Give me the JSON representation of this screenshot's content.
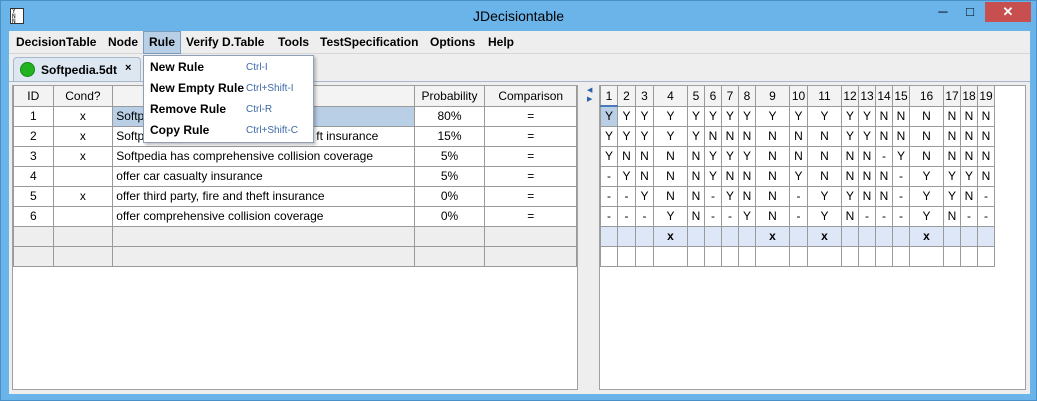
{
  "window": {
    "title": "JDecisiontable",
    "icon_text": "Y N\nN -",
    "minimize_glyph": "─",
    "maximize_glyph": "□",
    "close_glyph": "✕"
  },
  "menu": [
    "DecisionTable",
    "Node",
    "Rule",
    "Verify D.Table",
    "Tools",
    "TestSpecification",
    "Options",
    "Help"
  ],
  "rule_menu": {
    "items": [
      {
        "label": "New Rule",
        "accel": "Ctrl-I"
      },
      {
        "label": "New Empty Rule",
        "accel": "Ctrl+Shift-I"
      },
      {
        "label": "Remove Rule",
        "accel": "Ctrl-R"
      },
      {
        "label": "Copy Rule",
        "accel": "Ctrl+Shift-C"
      }
    ]
  },
  "tab": {
    "label": "Softpedia.5dt",
    "close": "×",
    "status_color": "#22b322"
  },
  "conditions_table": {
    "headers": [
      "ID",
      "Cond?",
      "",
      "Probability",
      "Comparison"
    ],
    "rows": [
      {
        "id": "1",
        "cond": "x",
        "text": "Softp",
        "probability": "80%",
        "comparison": "="
      },
      {
        "id": "2",
        "cond": "x",
        "text": "Softp",
        "probability": "15%",
        "comparison": "="
      },
      {
        "id": "3",
        "cond": "x",
        "text": "Softpedia has comprehensive collision coverage",
        "probability": "5%",
        "comparison": "="
      },
      {
        "id": "4",
        "cond": "",
        "text": "offer car casualty insurance",
        "probability": "5%",
        "comparison": "="
      },
      {
        "id": "5",
        "cond": "x",
        "text": "offer third party, fire and theft insurance",
        "probability": "0%",
        "comparison": "="
      },
      {
        "id": "6",
        "cond": "",
        "text": "offer comprehensive collision coverage",
        "probability": "0%",
        "comparison": "="
      }
    ],
    "partial_text_row1": "e",
    "partial_text_row2": "ft insurance"
  },
  "rules_table": {
    "headers": [
      "1",
      "2",
      "3",
      "4",
      "5",
      "6",
      "7",
      "8",
      "9",
      "10",
      "11",
      "12",
      "13",
      "14",
      "15",
      "16",
      "17",
      "18",
      "19"
    ],
    "rows": [
      [
        "Y",
        "Y",
        "Y",
        "Y",
        "Y",
        "Y",
        "Y",
        "Y",
        "Y",
        "Y",
        "Y",
        "Y",
        "Y",
        "N",
        "N",
        "N",
        "N",
        "N",
        "N"
      ],
      [
        "Y",
        "Y",
        "Y",
        "Y",
        "Y",
        "N",
        "N",
        "N",
        "N",
        "N",
        "N",
        "Y",
        "Y",
        "N",
        "N",
        "N",
        "N",
        "N",
        "N"
      ],
      [
        "Y",
        "N",
        "N",
        "N",
        "N",
        "Y",
        "Y",
        "Y",
        "N",
        "N",
        "N",
        "N",
        "N",
        "-",
        "Y",
        "N",
        "N",
        "N",
        "N"
      ],
      [
        "-",
        "Y",
        "N",
        "N",
        "N",
        "Y",
        "N",
        "N",
        "N",
        "Y",
        "N",
        "N",
        "N",
        "N",
        "-",
        "Y",
        "Y",
        "Y",
        "N"
      ],
      [
        "-",
        "-",
        "Y",
        "N",
        "N",
        "-",
        "Y",
        "N",
        "N",
        "-",
        "Y",
        "Y",
        "N",
        "N",
        "-",
        "Y",
        "Y",
        "N",
        "-"
      ],
      [
        "-",
        "-",
        "-",
        "Y",
        "N",
        "-",
        "-",
        "Y",
        "N",
        "-",
        "Y",
        "N",
        "-",
        "-",
        "-",
        "Y",
        "N",
        "-",
        "-"
      ]
    ],
    "mark_row": [
      "",
      "",
      "",
      "x",
      "",
      "",
      "",
      "",
      "x",
      "",
      "x",
      "",
      "",
      "",
      "",
      "x",
      "",
      "",
      ""
    ]
  }
}
